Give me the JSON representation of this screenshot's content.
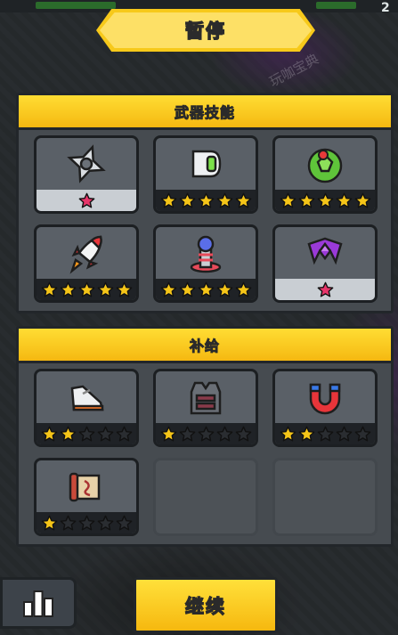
{
  "top": {
    "level_text": "2"
  },
  "title": "暂停",
  "weapons": {
    "header": "武器技能",
    "items": [
      {
        "icon": "shuriken-icon",
        "stars": 1,
        "max": 1
      },
      {
        "icon": "drone-pod-icon",
        "stars": 5,
        "max": 5
      },
      {
        "icon": "soccer-ball-icon",
        "stars": 5,
        "max": 5
      },
      {
        "icon": "rocket-icon",
        "stars": 5,
        "max": 5
      },
      {
        "icon": "tesla-coil-icon",
        "stars": 5,
        "max": 5
      },
      {
        "icon": "purple-boomerang-icon",
        "stars": 1,
        "max": 1
      }
    ]
  },
  "supplies": {
    "header": "补给",
    "items": [
      {
        "icon": "sneaker-icon",
        "stars": 2,
        "max": 5
      },
      {
        "icon": "armor-vest-icon",
        "stars": 1,
        "max": 5
      },
      {
        "icon": "magnet-icon",
        "stars": 2,
        "max": 5
      },
      {
        "icon": "scroll-icon",
        "stars": 1,
        "max": 5
      }
    ]
  },
  "watermark": "玩咖宝典",
  "continue_label": "继续",
  "colors": {
    "gold": "#f7c91a",
    "star_filled": "#f5c518",
    "star_empty": "#2a2d31",
    "star_pink": "#e8356a"
  }
}
